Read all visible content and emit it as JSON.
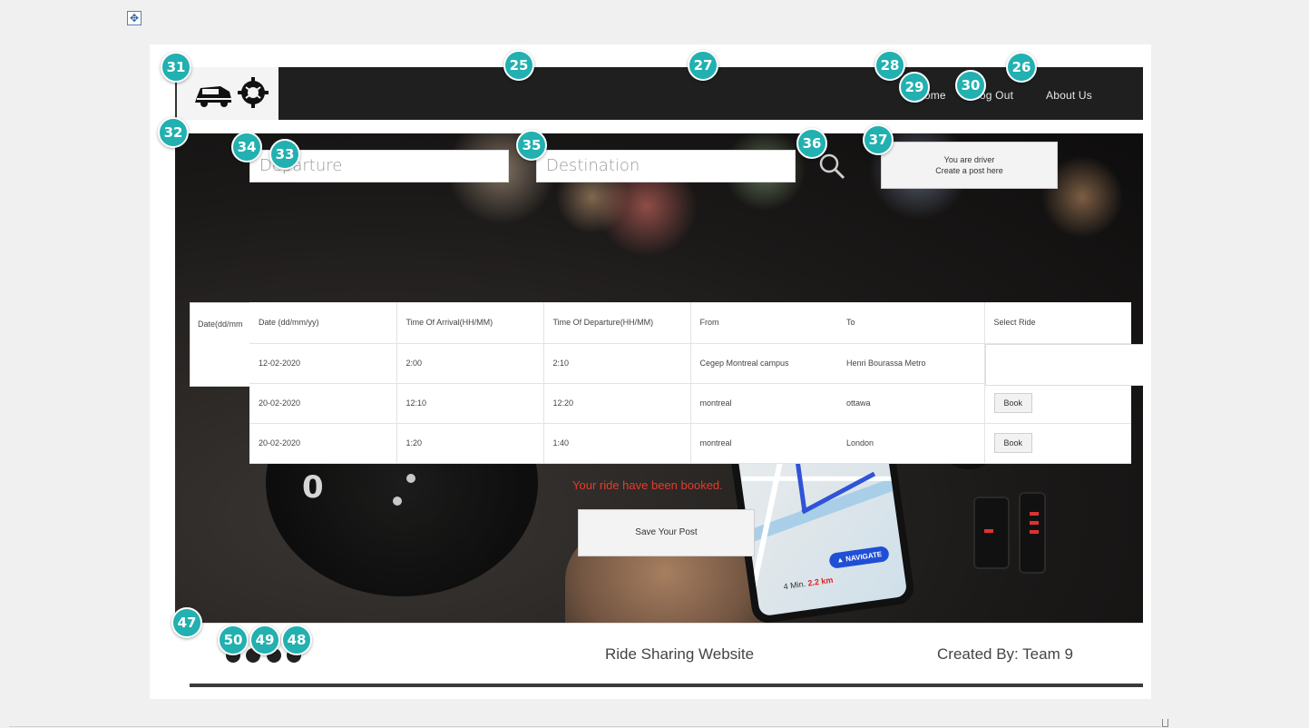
{
  "nav": {
    "links": [
      {
        "label": "Home"
      },
      {
        "label": "Log Out"
      },
      {
        "label": "About Us"
      }
    ]
  },
  "search": {
    "departure_placeholder": "Departure",
    "destination_placeholder": "Destination"
  },
  "driver_cta": {
    "line1": "You are driver",
    "line2": "Create a post here"
  },
  "table": {
    "ghost_header": "Date(dd/mm",
    "headers": [
      "Date (dd/mm/yy)",
      "Time Of Arrival(HH/MM)",
      "Time Of Departure(HH/MM)",
      "From",
      "To",
      "Select Ride"
    ],
    "rows": [
      {
        "date": "12-02-2020",
        "arrival": "2:00",
        "departure": "2:10",
        "from": "Cegep Montreal campus",
        "to": "Henri Bourassa Metro",
        "action": ""
      },
      {
        "date": "20-02-2020",
        "arrival": "12:10",
        "departure": "12:20",
        "from": "montreal",
        "to": "ottawa",
        "action": "Book"
      },
      {
        "date": "20-02-2020",
        "arrival": "1:20",
        "departure": "1:40",
        "from": "montreal",
        "to": "London",
        "action": "Book"
      }
    ]
  },
  "status": {
    "booked_message": "Your ride have been booked."
  },
  "save_post": {
    "label": "Save Your Post"
  },
  "phone_map": {
    "navigate": "▲ NAVIGATE",
    "eta_time": "4 Min.",
    "eta_distance": "2.2 km"
  },
  "dashboard": {
    "gauge_digit": "0"
  },
  "footer": {
    "title": "Ride Sharing Website",
    "credit": "Created By: Team 9"
  },
  "markers": [
    "31",
    "25",
    "27",
    "28",
    "29",
    "30",
    "26",
    "32",
    "34",
    "33",
    "35",
    "36",
    "37",
    "47",
    "50",
    "49",
    "48"
  ],
  "colors": {
    "navbar": "#1f1f1f",
    "marker": "#22b0b0",
    "booked_text": "#e33d2a"
  }
}
